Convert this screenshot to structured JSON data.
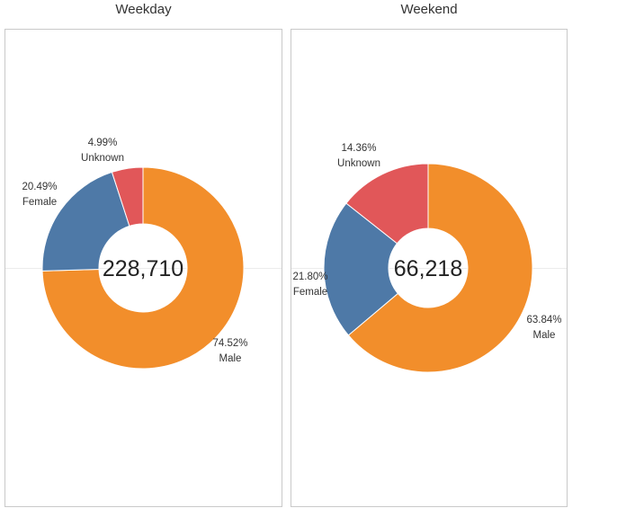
{
  "chart_data": [
    {
      "type": "pie",
      "title": "Weekday",
      "total_label": "228,710",
      "slices": [
        {
          "category": "Male",
          "percent_label": "74.52%",
          "value": 74.52,
          "color": "#f28e2b"
        },
        {
          "category": "Female",
          "percent_label": "20.49%",
          "value": 20.49,
          "color": "#4e79a7"
        },
        {
          "category": "Unknown",
          "percent_label": "4.99%",
          "value": 4.99,
          "color": "#e15759"
        }
      ]
    },
    {
      "type": "pie",
      "title": "Weekend",
      "total_label": "66,218",
      "slices": [
        {
          "category": "Male",
          "percent_label": "63.84%",
          "value": 63.84,
          "color": "#f28e2b"
        },
        {
          "category": "Female",
          "percent_label": "21.80%",
          "value": 21.8,
          "color": "#4e79a7"
        },
        {
          "category": "Unknown",
          "percent_label": "14.36%",
          "value": 14.36,
          "color": "#e15759"
        }
      ]
    }
  ]
}
